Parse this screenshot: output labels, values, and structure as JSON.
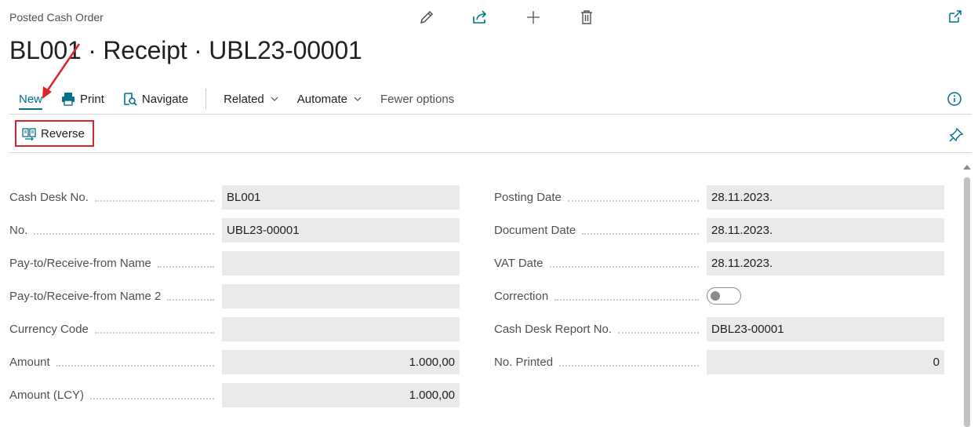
{
  "header": {
    "caption": "Posted Cash Order",
    "title": "BL001 · Receipt · UBL23-00001",
    "top_icons": [
      "edit-icon",
      "share-icon",
      "add-icon",
      "delete-icon"
    ],
    "popout_icon": "popout-icon"
  },
  "actions": {
    "new": "New",
    "print": "Print",
    "navigate": "Navigate",
    "related": "Related",
    "automate": "Automate",
    "fewer_options": "Fewer options",
    "reverse": "Reverse"
  },
  "fields_left": [
    {
      "label": "Cash Desk No.",
      "value": "BL001"
    },
    {
      "label": "No.",
      "value": "UBL23-00001"
    },
    {
      "label": "Pay-to/Receive-from Name",
      "value": ""
    },
    {
      "label": "Pay-to/Receive-from Name 2",
      "value": ""
    },
    {
      "label": "Currency Code",
      "value": ""
    },
    {
      "label": "Amount",
      "value": "1.000,00"
    },
    {
      "label": "Amount (LCY)",
      "value": "1.000,00"
    }
  ],
  "fields_right": [
    {
      "label": "Posting Date",
      "value": "28.11.2023."
    },
    {
      "label": "Document Date",
      "value": "28.11.2023."
    },
    {
      "label": "VAT Date",
      "value": "28.11.2023."
    },
    {
      "label": "Correction",
      "value": "off"
    },
    {
      "label": "Cash Desk Report No.",
      "value": "DBL23-00001"
    },
    {
      "label": "No. Printed",
      "value": "0"
    }
  ],
  "colors": {
    "accent": "#00728a",
    "highlight": "#d9232d",
    "field_bg": "#eaeaea"
  }
}
